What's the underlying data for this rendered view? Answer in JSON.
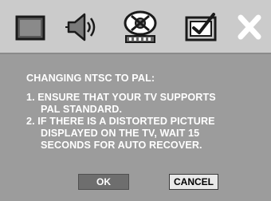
{
  "toolbar": {
    "icons": [
      "picture-icon",
      "audio-icon",
      "disc-setup-icon",
      "preferences-check-icon",
      "close-icon"
    ],
    "close_glyph": "✕"
  },
  "dialog": {
    "title": "CHANGING NTSC TO PAL:",
    "lines": [
      "1. ENSURE THAT YOUR TV SUPPORTS",
      "PAL STANDARD.",
      "2. IF THERE IS A DISTORTED PICTURE",
      "DISPLAYED ON THE TV, WAIT 15",
      "SECONDS FOR AUTO RECOVER."
    ],
    "ok_label": "OK",
    "cancel_label": "CANCEL"
  },
  "colors": {
    "toolbar_bg": "#cbcbcb",
    "panel_bg": "#9c9c9c",
    "text": "#ffffff"
  }
}
